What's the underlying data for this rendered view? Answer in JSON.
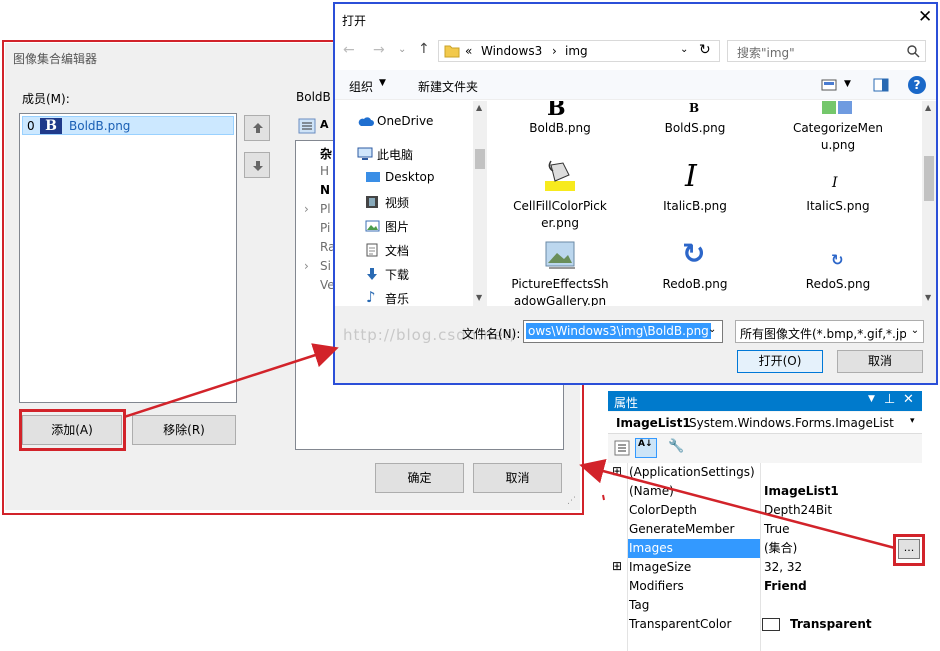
{
  "editor": {
    "title": "图像集合编辑器",
    "members_label": "成员(M):",
    "props_label": "BoldB",
    "member_index": "0",
    "member_icon_letter": "B",
    "member_name": "BoldB.png",
    "group_label": "杂",
    "prop_fragments": [
      "H",
      "N",
      "Pl",
      "Pi",
      "Ra",
      "Si",
      "Ve"
    ],
    "add_label": "添加(A)",
    "remove_label": "移除(R)",
    "ok_label": "确定",
    "cancel_label": "取消"
  },
  "dialog": {
    "title": "打开",
    "path": [
      "«",
      "Windows3",
      "›",
      "img"
    ],
    "search_placeholder": "搜索\"img\"",
    "organize_label": "组织",
    "new_folder_label": "新建文件夹",
    "nav": [
      {
        "label": "OneDrive",
        "icon": "cloud-icon"
      },
      {
        "label": "此电脑",
        "icon": "computer-icon"
      },
      {
        "label": "Desktop",
        "icon": "desktop-icon"
      },
      {
        "label": "视频",
        "icon": "video-icon"
      },
      {
        "label": "图片",
        "icon": "pictures-icon"
      },
      {
        "label": "文档",
        "icon": "documents-icon"
      },
      {
        "label": "下载",
        "icon": "download-icon"
      },
      {
        "label": "音乐",
        "icon": "music-icon"
      }
    ],
    "files": [
      {
        "line1": "BoldB.png",
        "line2": "",
        "icon": "bold-b-icon"
      },
      {
        "line1": "BoldS.png",
        "line2": "",
        "icon": "bold-s-icon"
      },
      {
        "line1": "CategorizeMen",
        "line2": "u.png",
        "icon": "categorize-icon"
      },
      {
        "line1": "CellFillColorPick",
        "line2": "er.png",
        "icon": "paint-bucket-icon"
      },
      {
        "line1": "ItalicB.png",
        "line2": "",
        "icon": "italic-b-icon"
      },
      {
        "line1": "ItalicS.png",
        "line2": "",
        "icon": "italic-s-icon"
      },
      {
        "line1": "PictureEffectsSh",
        "line2": "adowGallery.pn",
        "icon": "picture-icon"
      },
      {
        "line1": "RedoB.png",
        "line2": "",
        "icon": "redo-b-icon"
      },
      {
        "line1": "RedoS.png",
        "line2": "",
        "icon": "redo-s-icon"
      }
    ],
    "filename_label": "文件名(N):",
    "filename_value": "ows\\Windows3\\img\\BoldB.png",
    "filter_value": "所有图像文件(*.bmp,*.gif,*.jpg",
    "open_label": "打开(O)",
    "cancel_label": "取消",
    "watermark": "http://blog.csdn.net/"
  },
  "properties": {
    "title": "属性",
    "object_name": "ImageList1",
    "object_type": "System.Windows.Forms.ImageList",
    "rows": [
      {
        "name": "(ApplicationSettings)",
        "value": "",
        "expand": "⊞",
        "bold": false
      },
      {
        "name": "(Name)",
        "value": "ImageList1",
        "expand": "",
        "bold": true
      },
      {
        "name": "ColorDepth",
        "value": "Depth24Bit",
        "expand": "",
        "bold": false
      },
      {
        "name": "GenerateMember",
        "value": "True",
        "expand": "",
        "bold": false
      },
      {
        "name": "Images",
        "value": "(集合)",
        "expand": "",
        "bold": false
      },
      {
        "name": "ImageSize",
        "value": "32, 32",
        "expand": "⊞",
        "bold": false
      },
      {
        "name": "Modifiers",
        "value": "Friend",
        "expand": "",
        "bold": true
      },
      {
        "name": "Tag",
        "value": "",
        "expand": "",
        "bold": false
      },
      {
        "name": "TransparentColor",
        "value": "Transparent",
        "expand": "",
        "bold": true
      }
    ],
    "ellipsis_label": "...",
    "accent_color": "#007acc",
    "selection_color": "#3399ff"
  }
}
